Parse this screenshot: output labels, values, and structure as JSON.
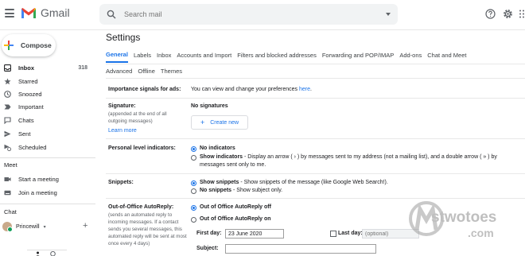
{
  "app": {
    "name": "Gmail"
  },
  "search": {
    "placeholder": "Search mail"
  },
  "header": {
    "icons": [
      "menu-icon",
      "help-icon",
      "gear-icon",
      "apps-icon"
    ]
  },
  "sidebar": {
    "compose_label": "Compose",
    "items": [
      {
        "label": "Inbox",
        "count": "318",
        "icon": "inbox-icon"
      },
      {
        "label": "Starred",
        "icon": "star-icon"
      },
      {
        "label": "Snoozed",
        "icon": "clock-icon"
      },
      {
        "label": "Important",
        "icon": "important-icon"
      },
      {
        "label": "Chats",
        "icon": "chat-icon"
      },
      {
        "label": "Sent",
        "icon": "send-icon"
      },
      {
        "label": "Scheduled",
        "icon": "schedule-icon"
      }
    ],
    "meet": {
      "heading": "Meet",
      "items": [
        {
          "label": "Start a meeting",
          "icon": "video-icon"
        },
        {
          "label": "Join a meeting",
          "icon": "keyboard-icon"
        }
      ]
    },
    "chat": {
      "heading": "Chat",
      "user": "Princewill"
    }
  },
  "settings": {
    "title": "Settings",
    "tabs": [
      "General",
      "Labels",
      "Inbox",
      "Accounts and Import",
      "Filters and blocked addresses",
      "Forwarding and POP/IMAP",
      "Add-ons",
      "Chat and Meet"
    ],
    "tabs_row2": [
      "Advanced",
      "Offline",
      "Themes"
    ],
    "importance": {
      "label": "Importance signals for ads:",
      "text": "You can view and change your preferences ",
      "link": "here",
      "end": "."
    },
    "signature": {
      "label": "Signature:",
      "sub": "(appended at the end of all outgoing messages)",
      "learn_more": "Learn more",
      "value": "No signatures",
      "button": "Create new"
    },
    "personal": {
      "label": "Personal level indicators:",
      "opt1": "No indicators",
      "opt2_bold": "Show indicators",
      "opt2_text": " - Display an arrow ( › ) by messages sent to my address (not a mailing list), and a double arrow ( » ) by",
      "opt2_text2": "messages sent only to me."
    },
    "snippets": {
      "label": "Snippets:",
      "opt1_bold": "Show snippets",
      "opt1_text": " - Show snippets of the message (like Google Web Search!).",
      "opt2_bold": "No snippets",
      "opt2_text": " - Show subject only."
    },
    "ooo": {
      "label": "Out-of-Office AutoReply:",
      "sub": "(sends an automated reply to incoming messages. If a contact sends you several messages, this automated reply will be sent at most once every 4 days)",
      "opt1": "Out of Office AutoReply off",
      "opt2": "Out of Office AutoReply on",
      "first_day_label": "First day:",
      "first_day_value": "23 June 2020",
      "last_day_label": "Last day:",
      "last_day_placeholder": "(optional)",
      "subject_label": "Subject:"
    }
  },
  "watermark": {
    "text": "stwotoes",
    "suffix": ".com"
  },
  "colors": {
    "accent": "#1a73e8",
    "gmail_red": "#ea4335"
  }
}
